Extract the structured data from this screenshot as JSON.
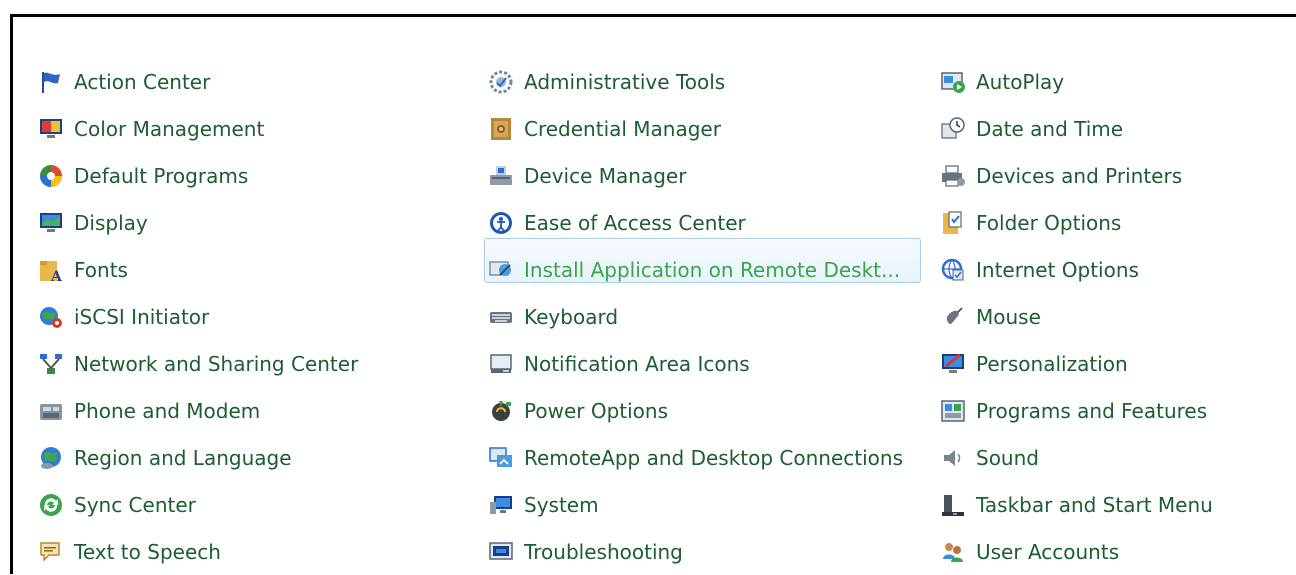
{
  "colors": {
    "link": "#1c5d31",
    "link_hover": "#3aa54d",
    "hover_border": "#a9cfe8"
  },
  "columns": [
    {
      "items": [
        {
          "label": "Action Center",
          "icon": "flag-icon"
        },
        {
          "label": "Color Management",
          "icon": "color-monitor-icon"
        },
        {
          "label": "Default Programs",
          "icon": "default-programs-icon"
        },
        {
          "label": "Display",
          "icon": "display-icon"
        },
        {
          "label": "Fonts",
          "icon": "fonts-folder-icon"
        },
        {
          "label": "iSCSI Initiator",
          "icon": "globe-network-icon"
        },
        {
          "label": "Network and Sharing Center",
          "icon": "network-icon"
        },
        {
          "label": "Phone and Modem",
          "icon": "phone-icon"
        },
        {
          "label": "Region and Language",
          "icon": "globe-icon"
        },
        {
          "label": "Sync Center",
          "icon": "sync-icon"
        },
        {
          "label": "Text to Speech",
          "icon": "speech-icon"
        }
      ]
    },
    {
      "items": [
        {
          "label": "Administrative Tools",
          "icon": "admin-tools-icon"
        },
        {
          "label": "Credential Manager",
          "icon": "vault-icon"
        },
        {
          "label": "Device Manager",
          "icon": "device-manager-icon"
        },
        {
          "label": "Ease of Access Center",
          "icon": "ease-of-access-icon"
        },
        {
          "label": "Install Application on Remote Deskt...",
          "icon": "install-remote-icon",
          "hover": true
        },
        {
          "label": "Keyboard",
          "icon": "keyboard-icon"
        },
        {
          "label": "Notification Area Icons",
          "icon": "notification-icon"
        },
        {
          "label": "Power Options",
          "icon": "power-icon"
        },
        {
          "label": "RemoteApp and Desktop Connections",
          "icon": "remoteapp-icon"
        },
        {
          "label": "System",
          "icon": "system-icon"
        },
        {
          "label": "Troubleshooting",
          "icon": "troubleshooting-icon"
        }
      ]
    },
    {
      "items": [
        {
          "label": "AutoPlay",
          "icon": "autoplay-icon"
        },
        {
          "label": "Date and Time",
          "icon": "clock-icon"
        },
        {
          "label": "Devices and Printers",
          "icon": "printer-icon"
        },
        {
          "label": "Folder Options",
          "icon": "folder-options-icon"
        },
        {
          "label": "Internet Options",
          "icon": "internet-options-icon"
        },
        {
          "label": "Mouse",
          "icon": "mouse-icon"
        },
        {
          "label": "Personalization",
          "icon": "personalization-icon"
        },
        {
          "label": "Programs and Features",
          "icon": "programs-icon"
        },
        {
          "label": "Sound",
          "icon": "speaker-icon"
        },
        {
          "label": "Taskbar and Start Menu",
          "icon": "taskbar-icon"
        },
        {
          "label": "User Accounts",
          "icon": "users-icon"
        }
      ]
    }
  ]
}
